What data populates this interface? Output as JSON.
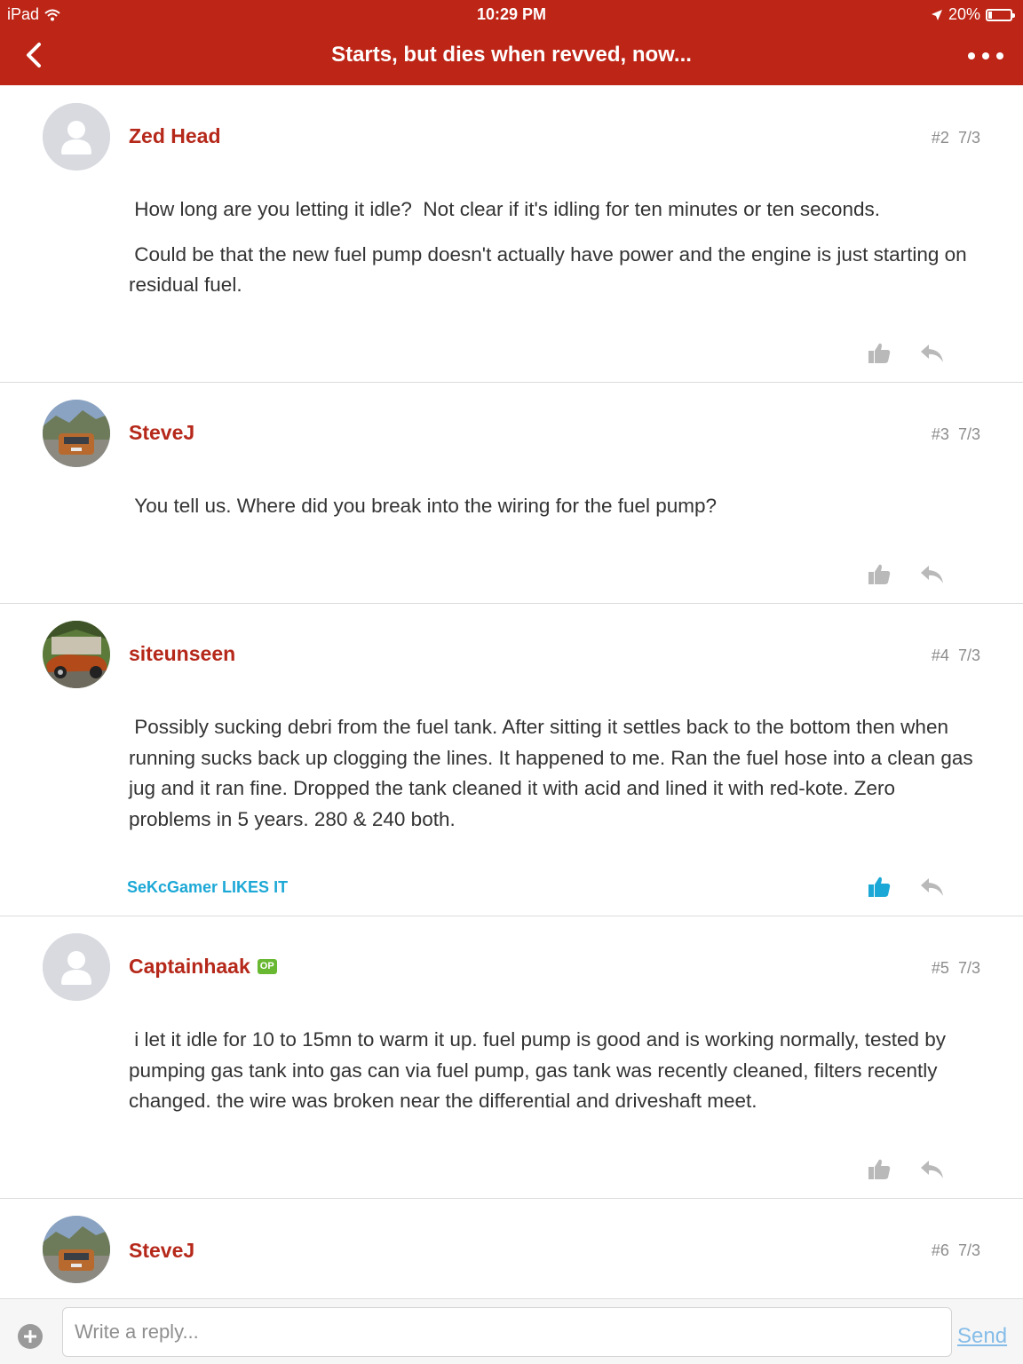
{
  "status_bar": {
    "device": "iPad",
    "time": "10:29 PM",
    "battery": "20%"
  },
  "nav": {
    "title": "Starts, but dies when revved, now..."
  },
  "posts": [
    {
      "author": "Zed Head",
      "number": "#2",
      "date": "7/3",
      "avatar": "default-avatar",
      "paragraphs": [
        " How long are you letting it idle?  Not clear if it's idling for ten minutes or ten seconds.",
        " Could be that the new fuel pump doesn't actually have power and the engine is just starting on residual fuel."
      ]
    },
    {
      "author": "SteveJ",
      "number": "#3",
      "date": "7/3",
      "avatar": "photo-avatar",
      "paragraphs": [
        " You tell us. Where did you break into the wiring for the fuel pump?"
      ]
    },
    {
      "author": "siteunseen",
      "number": "#4",
      "date": "7/3",
      "avatar": "photo-avatar",
      "paragraphs": [
        " Possibly sucking debri from the fuel tank. After sitting it settles back to the bottom then when running sucks back up clogging the lines. It happened to me. Ran the fuel hose into a clean gas jug and it ran fine. Dropped the tank cleaned it with acid and lined it with red-kote. Zero problems in 5 years. 280 & 240 both."
      ],
      "likes": "SeKcGamer LIKES IT"
    },
    {
      "author": "Captainhaak",
      "badge": "OP",
      "number": "#5",
      "date": "7/3",
      "avatar": "default-avatar",
      "paragraphs": [
        " i let it idle for 10 to 15mn to warm it up. fuel pump is good and is working normally, tested by pumping gas tank into gas can via fuel pump, gas tank was recently cleaned, filters recently changed. the wire was broken near the differential and driveshaft meet."
      ]
    },
    {
      "author": "SteveJ",
      "number": "#6",
      "date": "7/3",
      "avatar": "photo-avatar"
    }
  ],
  "reply": {
    "placeholder": "Write a reply...",
    "send_label": "Send"
  },
  "colors": {
    "header_bg": "#bd2516",
    "author": "#b5281a",
    "likes": "#1ca8d6",
    "liked_icon": "#1ca8d6",
    "send": "#86bde8"
  }
}
